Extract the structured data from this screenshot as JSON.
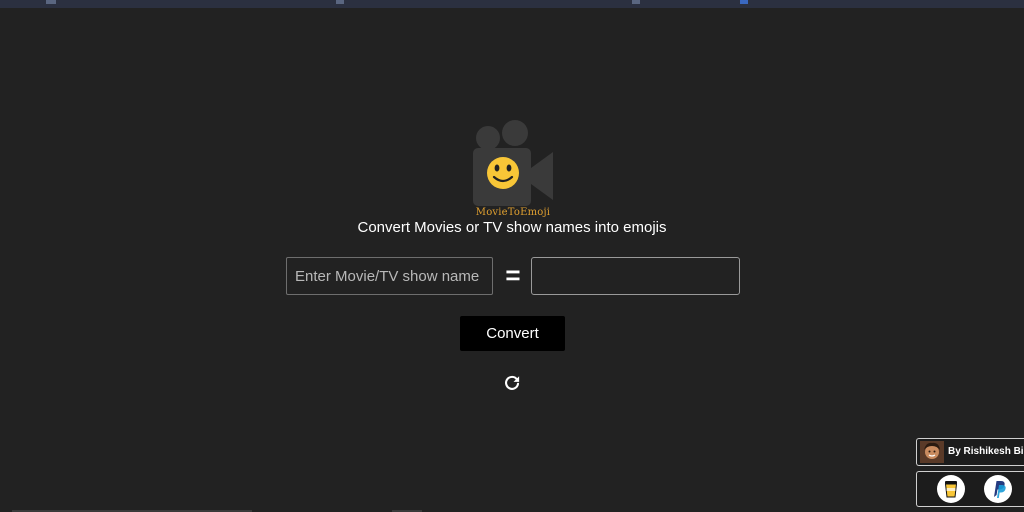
{
  "logo": {
    "caption": "MovieToEmoji",
    "icon": "camera-smiley-icon",
    "colors": {
      "camera": "#3a3a3a",
      "smiley": "#f8c637",
      "caption": "#e0a030"
    }
  },
  "tagline": "Convert Movies or TV show names into emojis",
  "converter": {
    "input_placeholder": "Enter Movie/TV show name",
    "input_value": "",
    "equals": "=",
    "output_value": "",
    "convert_label": "Convert",
    "refresh_icon": "refresh-icon"
  },
  "footer": {
    "credit_text": "By Rishikesh Bidk",
    "donate_icons": [
      "coffee-cup-icon",
      "paypal-icon"
    ]
  },
  "colors": {
    "background": "#222222",
    "button": "#000000",
    "text": "#ffffff"
  }
}
